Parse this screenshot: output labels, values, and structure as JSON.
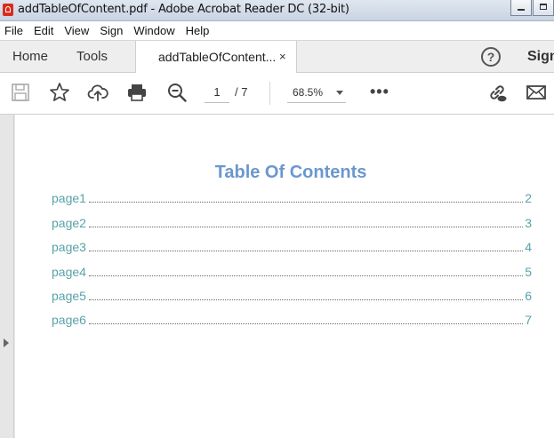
{
  "window": {
    "title": "addTableOfContent.pdf - Adobe Acrobat Reader DC (32-bit)"
  },
  "menu": [
    "File",
    "Edit",
    "View",
    "Sign",
    "Window",
    "Help"
  ],
  "tabs": {
    "home": "Home",
    "tools": "Tools",
    "doc": "addTableOfContent...",
    "close": "×",
    "help": "?",
    "sign": "Sign"
  },
  "toolbar": {
    "page_current": "1",
    "page_total": "/ 7",
    "zoom": "68.5%",
    "more": "•••"
  },
  "document": {
    "title": "Table Of Contents",
    "entries": [
      {
        "label": "page1",
        "page": "2"
      },
      {
        "label": "page2",
        "page": "3"
      },
      {
        "label": "page3",
        "page": "4"
      },
      {
        "label": "page4",
        "page": "5"
      },
      {
        "label": "page5",
        "page": "6"
      },
      {
        "label": "page6",
        "page": "7"
      }
    ]
  }
}
